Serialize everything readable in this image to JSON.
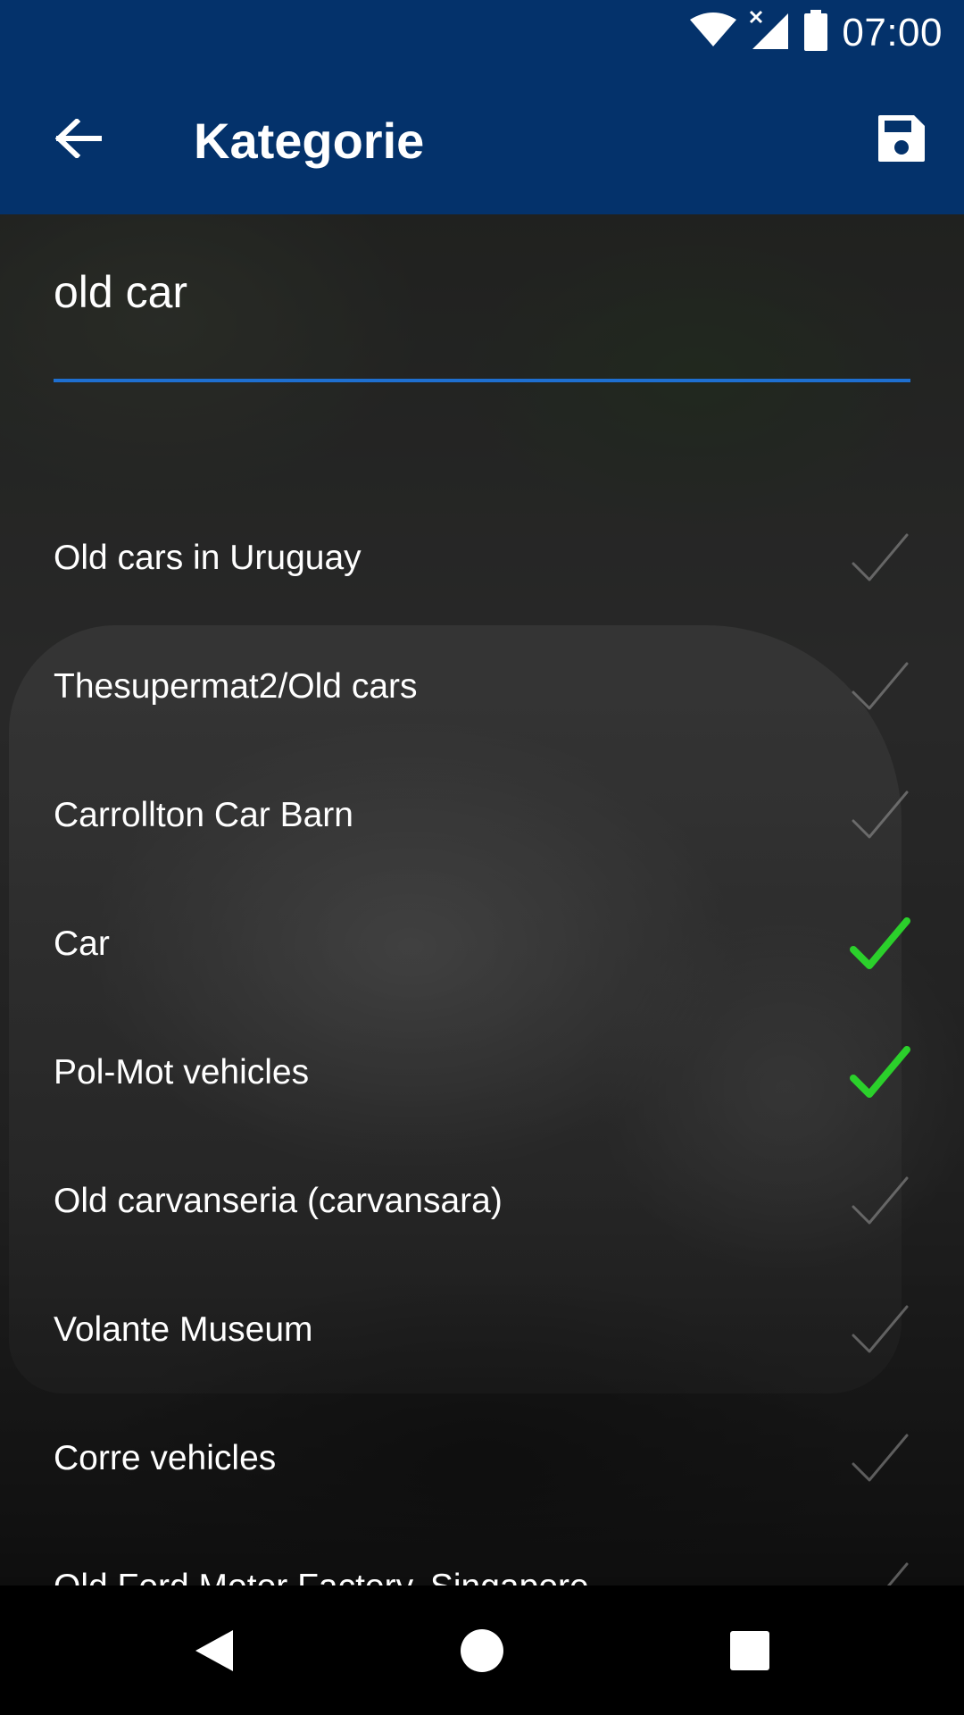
{
  "status_bar": {
    "time": "07:00",
    "icons": [
      "wifi-icon",
      "signal-no-service-icon",
      "battery-icon"
    ]
  },
  "app_bar": {
    "title": "Kategorie",
    "back_icon": "arrow-left-icon",
    "save_icon": "save-floppy-icon",
    "background_color": "#04326b"
  },
  "search": {
    "value": "old car",
    "placeholder": "",
    "underline_color": "#1e6fd0"
  },
  "categories": [
    {
      "label": "Old cars in Uruguay",
      "checked": false
    },
    {
      "label": "Thesupermat2/Old cars",
      "checked": false
    },
    {
      "label": "Carrollton Car Barn",
      "checked": false
    },
    {
      "label": "Car",
      "checked": true
    },
    {
      "label": "Pol-Mot vehicles",
      "checked": true
    },
    {
      "label": "Old carvanseria (carvansara)",
      "checked": false
    },
    {
      "label": "Volante Museum",
      "checked": false
    },
    {
      "label": "Corre vehicles",
      "checked": false
    },
    {
      "label": "Old Ford Motor Factory, Singapore",
      "checked": false
    }
  ],
  "colors": {
    "check_active": "#2bd02b",
    "check_inactive": "#9a9a9a"
  },
  "nav_bar": {
    "buttons": [
      "back-triangle-icon",
      "home-circle-icon",
      "recents-square-icon"
    ]
  }
}
